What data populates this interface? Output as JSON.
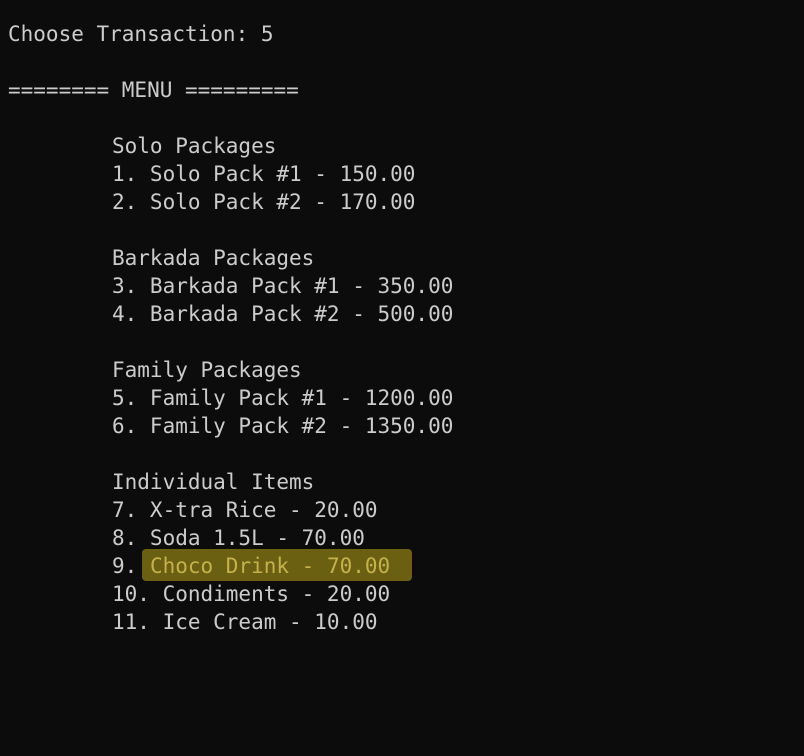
{
  "prompt": {
    "label": "Choose Transaction: 5"
  },
  "menu": {
    "header": "======== MENU ========="
  },
  "sections": [
    {
      "title": "Solo Packages",
      "items": [
        "1. Solo Pack #1 - 150.00",
        "2. Solo Pack #2 - 170.00"
      ]
    },
    {
      "title": "Barkada Packages",
      "items": [
        "3. Barkada Pack #1 - 350.00",
        "4. Barkada Pack #2 - 500.00"
      ]
    },
    {
      "title": "Family Packages",
      "items": [
        "5. Family Pack #1 - 1200.00",
        "6. Family Pack #2 - 1350.00"
      ]
    },
    {
      "title": "Individual Items",
      "items": [
        "7. X-tra Rice - 20.00",
        "8. Soda 1.5L - 70.00",
        {
          "number": "9.",
          "highlighted_text": "Choco Drink - 70.00"
        },
        "10. Condiments - 20.00",
        "11. Ice Cream - 10.00"
      ]
    }
  ],
  "colors": {
    "background": "#0c0c0c",
    "text": "#cccccc",
    "highlight": "#6b5f12",
    "highlight_text": "#c5b24a"
  }
}
